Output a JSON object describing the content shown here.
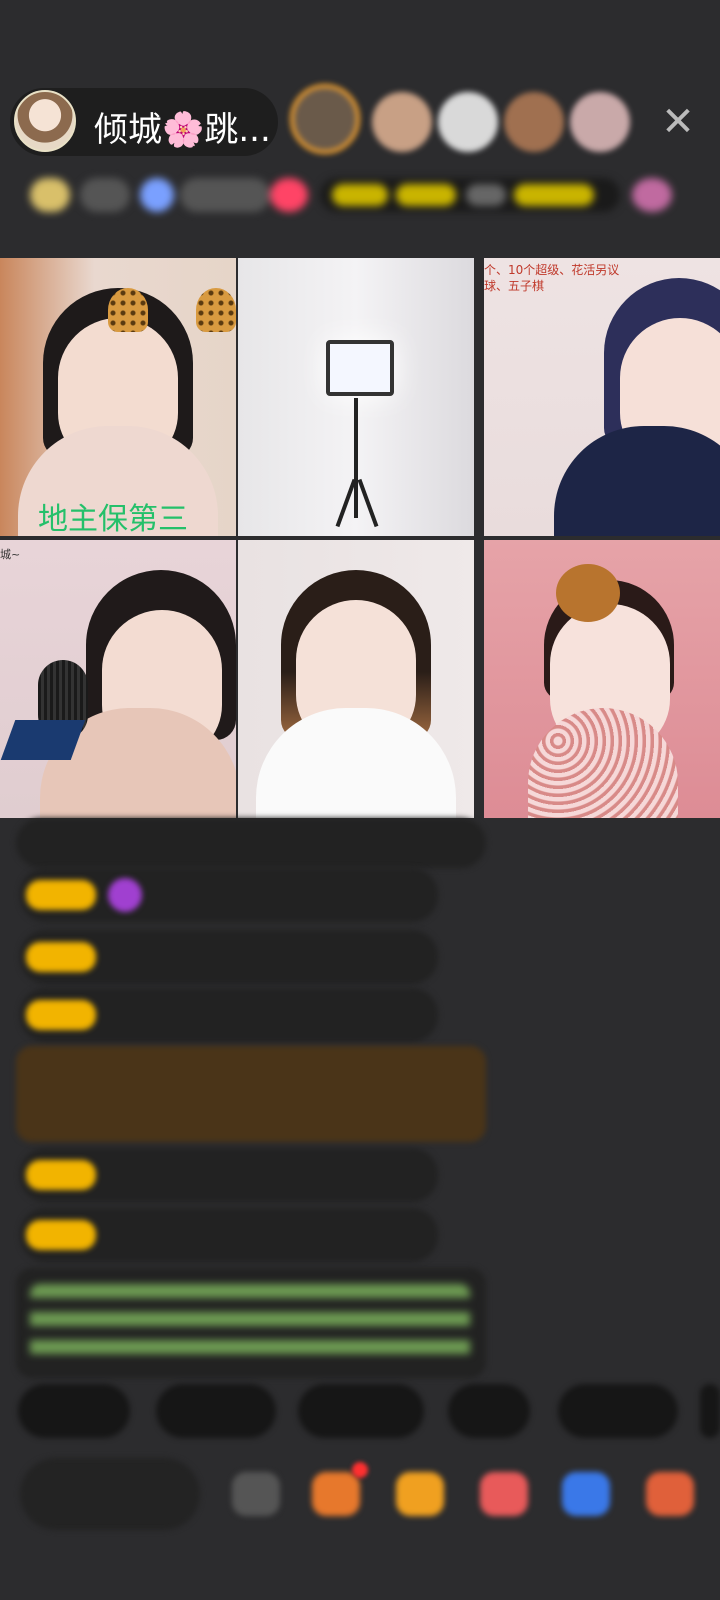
{
  "header": {
    "host_name": "倾城🌸跳...",
    "close_symbol": "✕"
  },
  "grid": {
    "tiles": [
      {
        "caption": "地主保第三"
      },
      {
        "caption": ""
      },
      {
        "caption": "个、10个超级、花活另议\n球、五子棋"
      },
      {
        "caption": "城~"
      },
      {
        "caption": ""
      },
      {
        "caption": ""
      }
    ]
  },
  "colors": {
    "background": "#2c2c2e",
    "badge": "#f2b400",
    "highlight_message": "#4a3418",
    "caption_green": "#24c06a",
    "caption_red": "#c0392b"
  },
  "icons": [
    "host-avatar",
    "close-icon",
    "microphone-icon",
    "ring-light-icon",
    "bear-hairclip-icon",
    "leopard-ears-icon"
  ]
}
